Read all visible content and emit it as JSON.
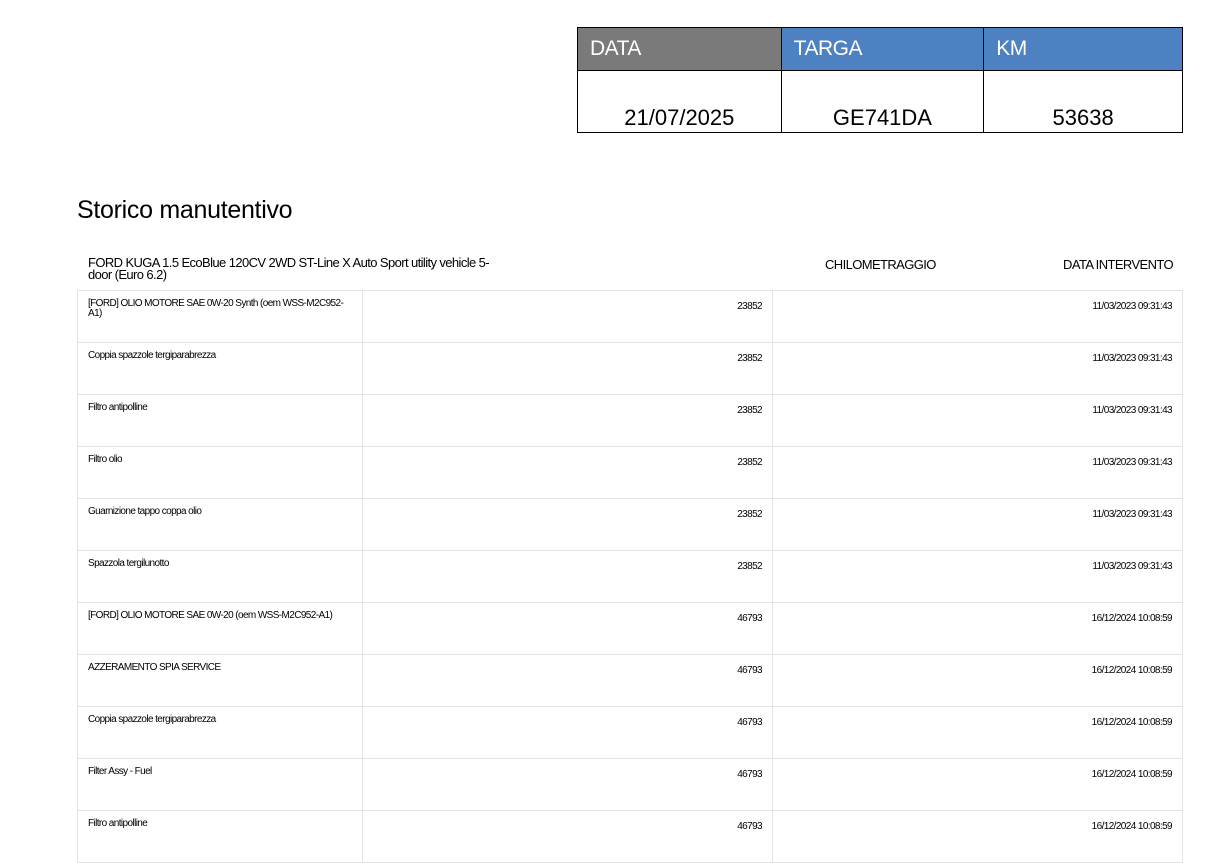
{
  "summary": {
    "date_label": "DATA",
    "plate_label": "TARGA",
    "km_label": "KM",
    "date_value": "21/07/2025",
    "plate_value": "GE741DA",
    "km_value": "53638",
    "colors": {
      "date_header_bg": "#7a7a7a",
      "header_bg": "#4e81c1",
      "header_text": "#ffffff"
    }
  },
  "history": {
    "title": "Storico manutentivo",
    "vehicle": "FORD KUGA 1.5 EcoBlue 120CV 2WD ST-Line X Auto Sport utility vehicle 5-door (Euro 6.2)",
    "col_km": "CHILOMETRAGGIO",
    "col_date": "DATA INTERVENTO",
    "rows": [
      {
        "desc": "[FORD] OLIO MOTORE SAE 0W-20 Synth (oem WSS-M2C952-A1)",
        "km": "23852",
        "date": "11/03/2023 09:31:43"
      },
      {
        "desc": "Coppia spazzole tergiparabrezza",
        "km": "23852",
        "date": "11/03/2023 09:31:43"
      },
      {
        "desc": "Filtro antipolline",
        "km": "23852",
        "date": "11/03/2023 09:31:43"
      },
      {
        "desc": "Filtro olio",
        "km": "23852",
        "date": "11/03/2023 09:31:43"
      },
      {
        "desc": "Guarnizione tappo coppa olio",
        "km": "23852",
        "date": "11/03/2023 09:31:43"
      },
      {
        "desc": "Spazzola tergilunotto",
        "km": "23852",
        "date": "11/03/2023 09:31:43"
      },
      {
        "desc": "[FORD] OLIO MOTORE SAE 0W-20 (oem WSS-M2C952-A1)",
        "km": "46793",
        "date": "16/12/2024 10:08:59"
      },
      {
        "desc": "AZZERAMENTO SPIA SERVICE",
        "km": "46793",
        "date": "16/12/2024 10:08:59"
      },
      {
        "desc": "Coppia spazzole tergiparabrezza",
        "km": "46793",
        "date": "16/12/2024 10:08:59"
      },
      {
        "desc": "Filter Assy - Fuel",
        "km": "46793",
        "date": "16/12/2024 10:08:59"
      },
      {
        "desc": "Filtro antipolline",
        "km": "46793",
        "date": "16/12/2024 10:08:59"
      }
    ]
  }
}
